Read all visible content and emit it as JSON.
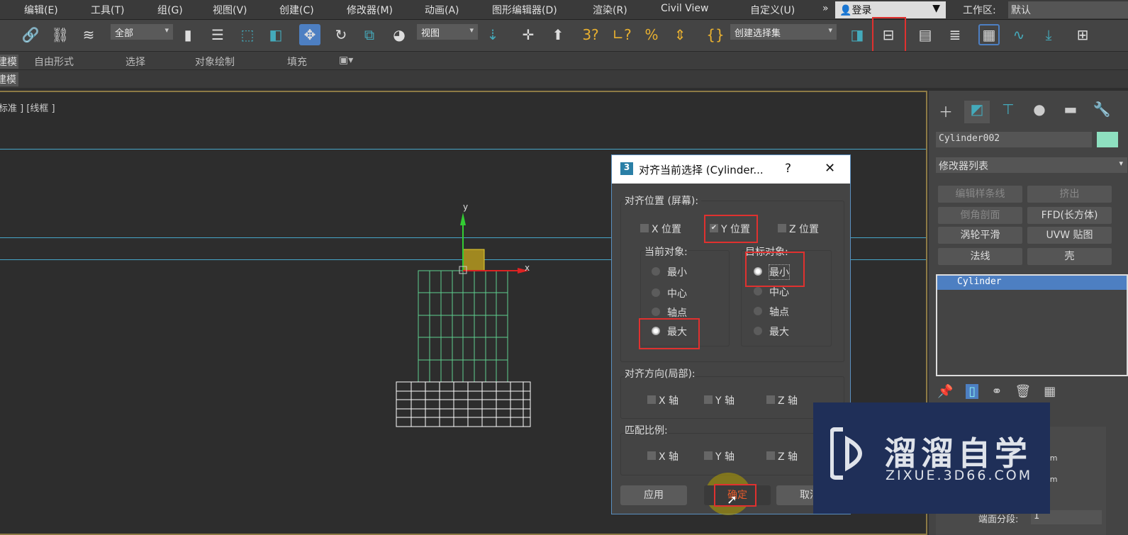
{
  "menubar": {
    "items": [
      "编辑(E)",
      "工具(T)",
      "组(G)",
      "视图(V)",
      "创建(C)",
      "修改器(M)",
      "动画(A)",
      "图形编辑器(D)",
      "渲染(R)",
      "Civil View",
      "自定义(U)"
    ],
    "overflow": "»",
    "login": "登录",
    "workspace_label": "工作区:",
    "workspace_value": "默认"
  },
  "toolbar": {
    "selection_filter": "全部",
    "ref_coord": "视图",
    "named_selection": "创建选择集",
    "icons": [
      "link-icon",
      "unlink-icon",
      "bind-space-warp-icon",
      "select-object-icon",
      "select-by-name-icon",
      "rect-selection-icon",
      "window-crossing-icon",
      "move-icon",
      "rotate-icon",
      "scale-icon",
      "placement-icon",
      "pivot-icon",
      "snap-toggle-icon",
      "manipulate-icon",
      "angle-snap-icon",
      "percent-snap-icon",
      "spinner-snap-icon",
      "edit-named-selection-icon",
      "mirror-icon",
      "align-icon",
      "scene-explorer-icon",
      "layer-explorer-icon",
      "toggle-ribbon-icon",
      "curve-editor-icon",
      "schematic-view-icon",
      "render-setup-icon"
    ],
    "active": "align-icon"
  },
  "ribbon": {
    "tabs": [
      "建模",
      "自由形式",
      "选择",
      "对象绘制",
      "填充"
    ],
    "subtab": "建模"
  },
  "viewport": {
    "label": "[+] [顶] [标准] [线框]",
    "label_visible": "标准 ] [线框 ]",
    "axis_x": "x",
    "axis_y": "y"
  },
  "panel": {
    "tabs": [
      "create-icon",
      "modify-icon",
      "hierarchy-icon",
      "motion-icon",
      "display-icon",
      "utilities-icon"
    ],
    "object_name": "Cylinder002",
    "object_color": "#8ee0c0",
    "modifier_list": "修改器列表",
    "buttons": [
      {
        "label": "编辑样条线",
        "enabled": false
      },
      {
        "label": "挤出",
        "enabled": false
      },
      {
        "label": "倒角剖面",
        "enabled": false
      },
      {
        "label": "FFD(长方体)",
        "enabled": true
      },
      {
        "label": "涡轮平滑",
        "enabled": true
      },
      {
        "label": "UVW 贴图",
        "enabled": true
      },
      {
        "label": "法线",
        "enabled": true
      },
      {
        "label": "壳",
        "enabled": true
      }
    ],
    "stack": [
      "Cylinder"
    ],
    "unit1": "mm",
    "unit2": "mm",
    "cap_segments_label": "端面分段:",
    "cap_segments_value": "1"
  },
  "dialog": {
    "title": "对齐当前选择 (Cylinder...",
    "help": "?",
    "close": "✕",
    "align_position": "对齐位置 (屏幕):",
    "x_pos": "X 位置",
    "y_pos": "Y 位置",
    "z_pos": "Z 位置",
    "x_checked": false,
    "y_checked": true,
    "z_checked": false,
    "current_object": "当前对象:",
    "target_object": "目标对象:",
    "options": [
      "最小",
      "中心",
      "轴点",
      "最大"
    ],
    "current_selected": "最大",
    "target_selected": "最小",
    "align_orientation": "对齐方向(局部):",
    "match_scale": "匹配比例:",
    "x_axis": "X 轴",
    "y_axis": "Y 轴",
    "z_axis": "Z 轴",
    "apply": "应用",
    "ok": "确定",
    "cancel": "取消"
  },
  "watermark": {
    "text": "溜溜自学",
    "url": "ZIXUE.3D66.COM",
    "color": "#1f2f58"
  },
  "highlight_color": "#e0312f"
}
